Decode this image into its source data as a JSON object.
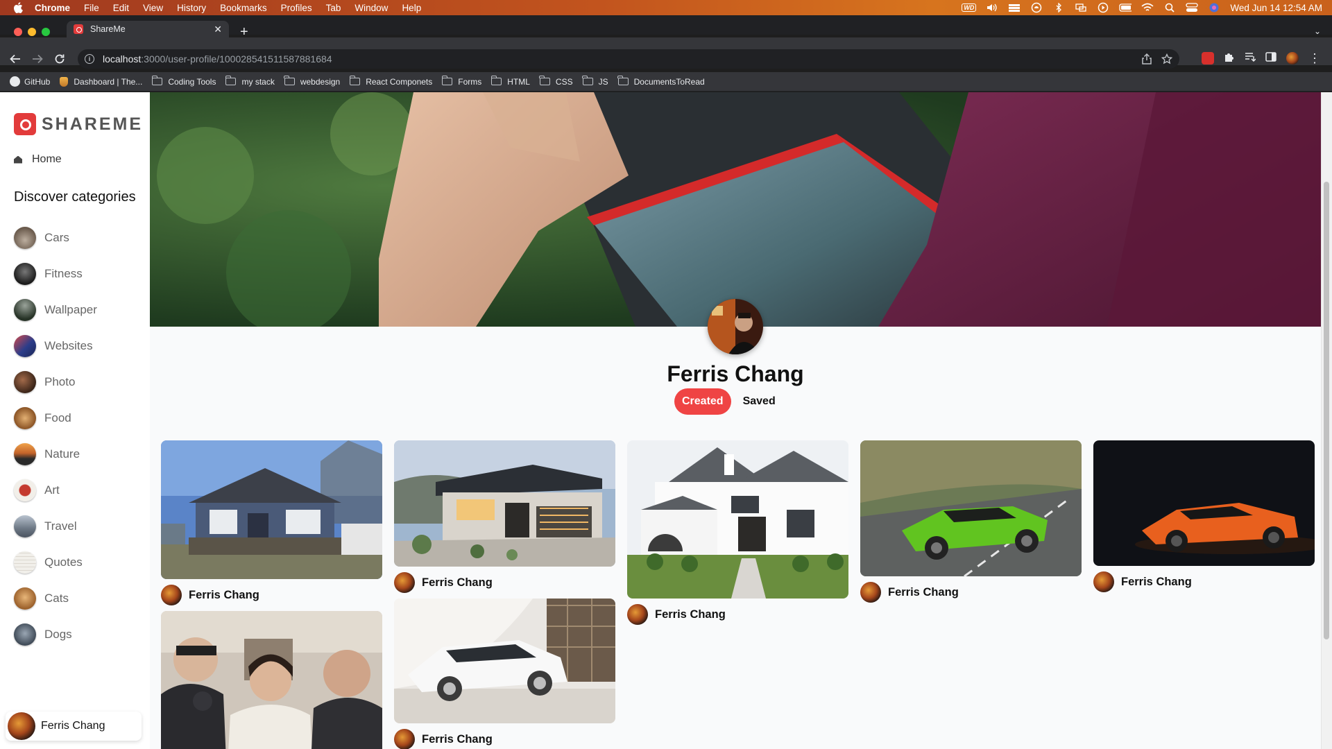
{
  "menubar": {
    "app": "Chrome",
    "items": [
      "File",
      "Edit",
      "View",
      "History",
      "Bookmarks",
      "Profiles",
      "Tab",
      "Window",
      "Help"
    ],
    "clock": "Wed Jun 14  12:54 AM"
  },
  "browser": {
    "tab_title": "ShareMe",
    "url_host": "localhost",
    "url_path": ":3000/user-profile/100028541511587881684",
    "bookmarks": [
      "GitHub",
      "Dashboard | The...",
      "Coding Tools",
      "my stack",
      "webdesign",
      "React Componets",
      "Forms",
      "HTML",
      "CSS",
      "JS",
      "DocumentsToRead"
    ]
  },
  "sidebar": {
    "brand": "SHAREME",
    "home_label": "Home",
    "discover_title": "Discover categories",
    "categories": [
      {
        "label": "Cars",
        "color": "#7a6a5a"
      },
      {
        "label": "Fitness",
        "color": "#2e2e2e"
      },
      {
        "label": "Wallpaper",
        "color": "#3c4a3a"
      },
      {
        "label": "Websites",
        "color": "#2c3d8a"
      },
      {
        "label": "Photo",
        "color": "#5a3a2a"
      },
      {
        "label": "Food",
        "color": "#b37a3a"
      },
      {
        "label": "Nature",
        "color": "#c47b34"
      },
      {
        "label": "Art",
        "color": "#e7e2dc"
      },
      {
        "label": "Travel",
        "color": "#7d8794"
      },
      {
        "label": "Quotes",
        "color": "#e8e6e1"
      },
      {
        "label": "Cats",
        "color": "#c78a45"
      },
      {
        "label": "Dogs",
        "color": "#5d6b7b"
      }
    ],
    "user_name": "Ferris Chang"
  },
  "profile": {
    "name": "Ferris Chang",
    "tab_created": "Created",
    "tab_saved": "Saved"
  },
  "pins": {
    "author": "Ferris Chang"
  }
}
